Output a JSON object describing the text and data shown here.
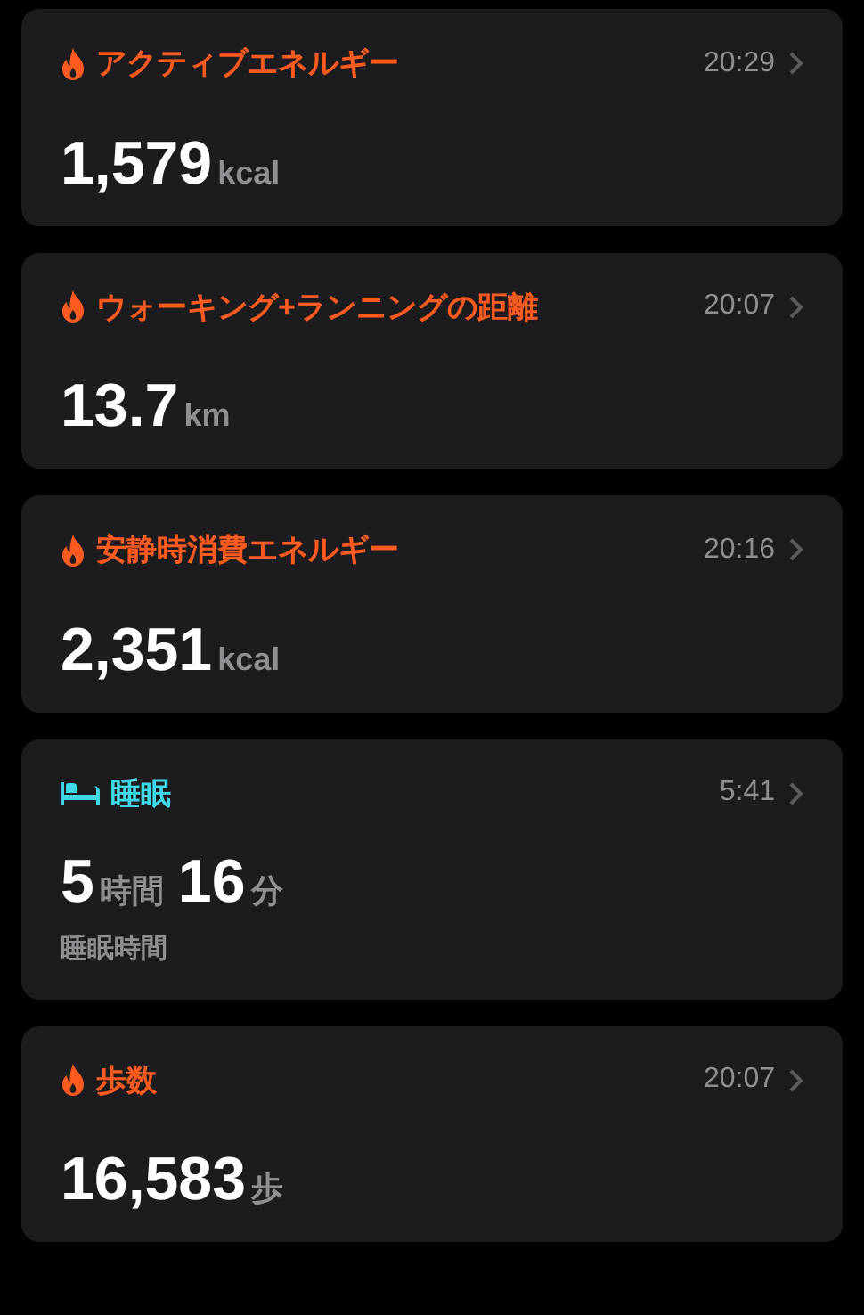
{
  "cards": [
    {
      "kind": "flame",
      "color": "#ff5a1f",
      "title": "アクティブエネルギー",
      "time": "20:29",
      "value": [
        {
          "number": "1,579",
          "unit": "kcal"
        }
      ]
    },
    {
      "kind": "flame",
      "color": "#ff5a1f",
      "title": "ウォーキング+ランニングの距離",
      "time": "20:07",
      "value": [
        {
          "number": "13.7",
          "unit": "km"
        }
      ]
    },
    {
      "kind": "flame",
      "color": "#ff5a1f",
      "title": "安静時消費エネルギー",
      "time": "20:16",
      "value": [
        {
          "number": "2,351",
          "unit": "kcal"
        }
      ]
    },
    {
      "kind": "bed",
      "color": "#3fd8e4",
      "title": "睡眠",
      "time": "5:41",
      "value": [
        {
          "number": "5",
          "unit": "時間"
        },
        {
          "number": "16",
          "unit": "分"
        }
      ],
      "caption": "睡眠時間"
    },
    {
      "kind": "flame",
      "color": "#ff5a1f",
      "title": "歩数",
      "time": "20:07",
      "value": [
        {
          "number": "16,583",
          "unit": "歩"
        }
      ]
    }
  ]
}
